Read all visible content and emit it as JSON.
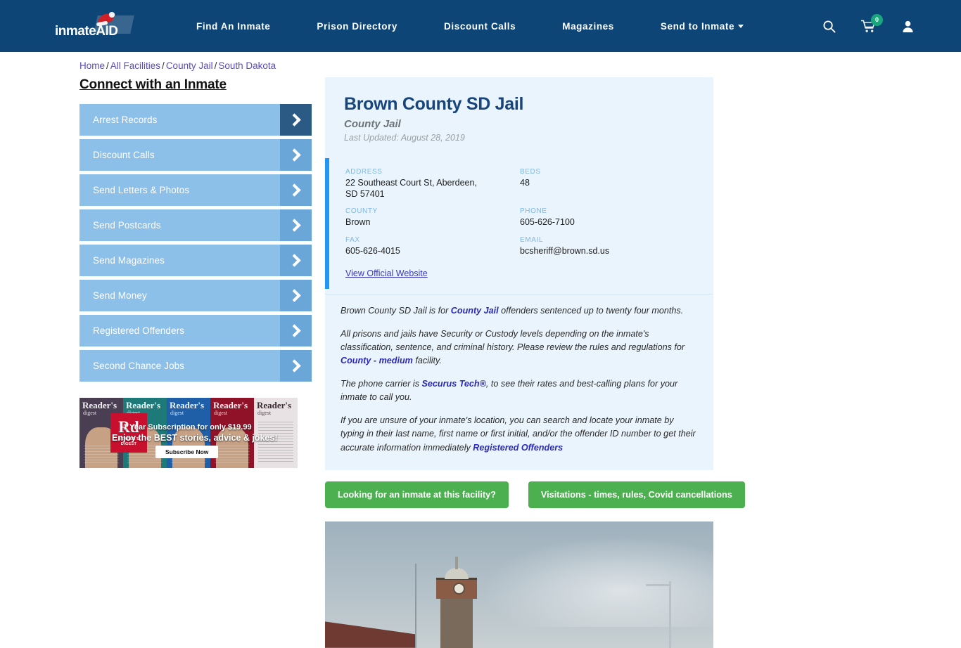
{
  "brand": {
    "name_part1": "inmate",
    "name_part2": "AID"
  },
  "nav": {
    "links": [
      {
        "label": "Find An Inmate"
      },
      {
        "label": "Prison Directory"
      },
      {
        "label": "Discount Calls"
      },
      {
        "label": "Magazines"
      },
      {
        "label": "Send to Inmate",
        "has_dropdown": true
      }
    ],
    "icons": {
      "search": "search-icon",
      "cart": "cart-icon",
      "cart_count": "0",
      "account": "user-icon"
    }
  },
  "breadcrumb": {
    "items": [
      "Home",
      "All Facilities",
      "County Jail",
      "South Dakota"
    ],
    "separator": "/"
  },
  "sidebar": {
    "title": "Connect with an Inmate",
    "items": [
      {
        "label": "Arrest Records",
        "primary": true
      },
      {
        "label": "Discount Calls",
        "primary": false
      },
      {
        "label": "Send Letters & Photos",
        "primary": false
      },
      {
        "label": "Send Postcards",
        "primary": false
      },
      {
        "label": "Send Magazines",
        "primary": false
      },
      {
        "label": "Send Money",
        "primary": false
      },
      {
        "label": "Registered Offenders",
        "primary": false
      },
      {
        "label": "Second Chance Jobs",
        "primary": false
      }
    ]
  },
  "ad": {
    "brand": "Rd",
    "brand_sub": "READER'S DIGEST",
    "cover_title": "Reader's",
    "cover_sub": "digest",
    "line1": "1 Year Subscription for only $19.99",
    "line2": "Enjoy the BEST stories, advice & jokes!",
    "cta": "Subscribe Now"
  },
  "facility": {
    "title": "Brown County SD Jail",
    "subtitle": "County Jail",
    "last_updated": "Last Updated: August 28, 2019",
    "fields": [
      {
        "label": "ADDRESS",
        "value": "22 Southeast Court St, Aberdeen, SD 57401"
      },
      {
        "label": "BEDS",
        "value": "48"
      },
      {
        "label": "COUNTY",
        "value": "Brown"
      },
      {
        "label": "PHONE",
        "value": "605-626-7100"
      },
      {
        "label": "FAX",
        "value": "605-626-4015"
      },
      {
        "label": "EMAIL",
        "value": "bcsheriff@brown.sd.us"
      }
    ],
    "official_website_link": "View Official Website",
    "paragraphs": {
      "p1_a": "Brown County SD Jail is for ",
      "p1_link": "County Jail",
      "p1_b": " offenders sentenced up to twenty four months.",
      "p2_a": "All prisons and jails have Security or Custody levels depending on the inmate's classification, sentence, and criminal history. Please review the rules and regulations for ",
      "p2_link": "County - medium",
      "p2_b": " facility.",
      "p3_a": "The phone carrier is ",
      "p3_link": "Securus Tech®",
      "p3_b": ", to see their rates and best-calling plans for your inmate to call you.",
      "p4_a": "If you are unsure of your inmate's location, you can search and locate your inmate by typing in their last name, first name or first initial, and/or the offender ID number to get their accurate information immediately ",
      "p4_link": "Registered Offenders"
    },
    "cta_buttons": [
      {
        "label": "Looking for an inmate at this facility?"
      },
      {
        "label": "Visitations - times, rules, Covid cancellations"
      }
    ]
  },
  "colors": {
    "nav_bg": "#0d4577",
    "panel_bg": "#e9f4fd",
    "accent_blue": "#2196f3",
    "sidebar_btn": "#8dc0e8",
    "sidebar_btn_arrow": "#6aa6d8",
    "sidebar_btn_arrow_primary": "#2b5b85",
    "cta_green": "#4caf50",
    "title_navy": "#17457c",
    "link_blue": "#2b2bb5",
    "cart_badge_green": "#1aa67c"
  }
}
